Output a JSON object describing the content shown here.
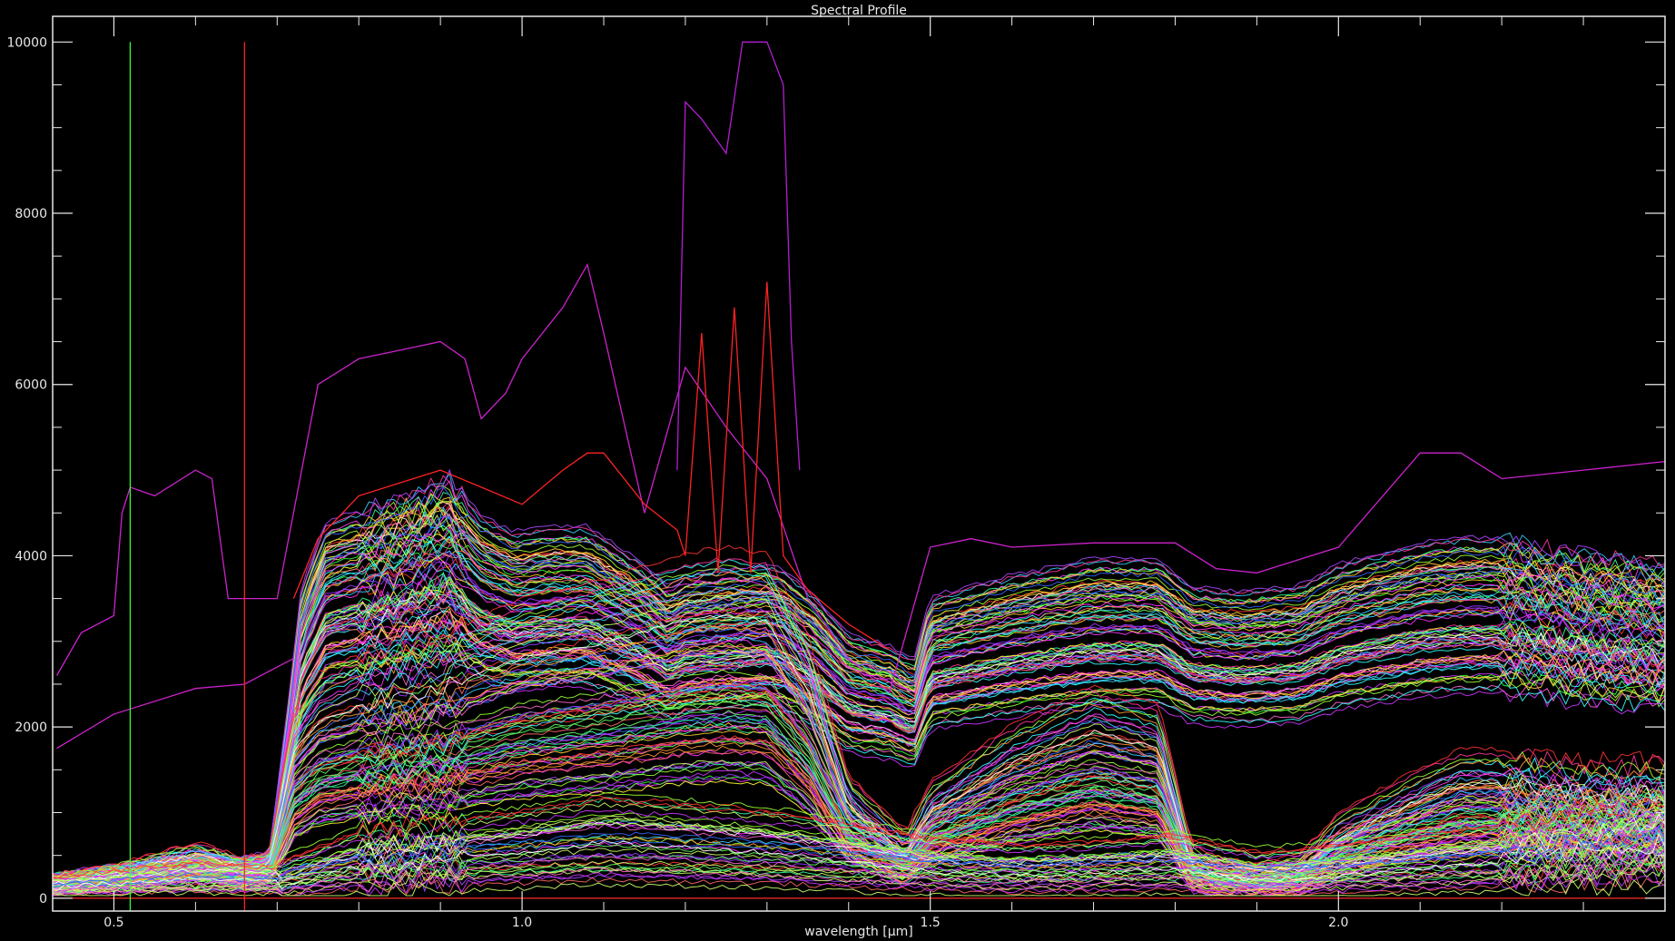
{
  "chart_data": {
    "type": "line",
    "title": "Spectral Profile",
    "xlabel": "wavelength [μm]",
    "ylabel": "",
    "xlim": [
      0.425,
      2.4
    ],
    "ylim": [
      -150,
      10300
    ],
    "x_ticks": [
      0.5,
      1.0,
      1.5,
      2.0
    ],
    "x_tick_labels": [
      "0.5",
      "1.0",
      "1.5",
      "2.0"
    ],
    "y_ticks": [
      0,
      2000,
      4000,
      6000,
      8000,
      10000
    ],
    "y_tick_labels": [
      "0",
      "2000",
      "4000",
      "6000",
      "8000",
      "10000"
    ],
    "y_minor_step": 500,
    "x_minor_step": 0.1,
    "grid": false,
    "background": "#000000",
    "axis_color": "#e8e8e8",
    "markers": [
      {
        "x": 0.52,
        "color": "#33ff33"
      },
      {
        "x": 0.66,
        "color": "#ff2222"
      }
    ],
    "baseline": {
      "y": 0,
      "color": "#ff2a2a"
    },
    "series": [
      {
        "color": "#cc22cc",
        "x": [
          0.43,
          0.46,
          0.5,
          0.51,
          0.52,
          0.55,
          0.6,
          0.62,
          0.64,
          0.7,
          0.75,
          0.8,
          0.85,
          0.9,
          0.93,
          0.95,
          0.98,
          1.0,
          1.05,
          1.08,
          1.1,
          1.15,
          1.2,
          1.25,
          1.3,
          1.35,
          1.4,
          1.45,
          1.5,
          1.55,
          1.6,
          1.7,
          1.8,
          1.85,
          1.9,
          2.0,
          2.1,
          2.15,
          2.2,
          2.3,
          2.4
        ],
        "y": [
          2600,
          3100,
          3300,
          4500,
          4800,
          4700,
          5000,
          4900,
          3500,
          3500,
          6000,
          6300,
          6400,
          6500,
          6300,
          5600,
          5900,
          6300,
          6900,
          7400,
          6600,
          4500,
          6200,
          5500,
          4900,
          3500,
          2800,
          2400,
          4100,
          4200,
          4100,
          4150,
          4150,
          3850,
          3800,
          4100,
          5200,
          5200,
          4900,
          5000,
          5100
        ]
      },
      {
        "color": "#cc22cc",
        "x": [
          0.43,
          0.5,
          0.6,
          0.66,
          0.7,
          0.72
        ],
        "y": [
          1750,
          2150,
          2450,
          2500,
          2700,
          2800
        ]
      },
      {
        "color": "#b21ed2",
        "x": [
          1.19,
          1.2,
          1.22,
          1.25,
          1.27,
          1.3,
          1.32,
          1.33,
          1.34
        ],
        "y": [
          5000,
          9300,
          9100,
          8700,
          10000,
          10000,
          9500,
          6500,
          5000
        ]
      },
      {
        "color": "#ff2222",
        "x": [
          0.72,
          0.75,
          0.8,
          0.9,
          0.95,
          1.0,
          1.05,
          1.08,
          1.1,
          1.15,
          1.19,
          1.2,
          1.22,
          1.24,
          1.26,
          1.28,
          1.3,
          1.32,
          1.35,
          1.4,
          1.45
        ],
        "y": [
          3500,
          4200,
          4700,
          5000,
          4800,
          4600,
          5000,
          5200,
          5200,
          4600,
          4300,
          4000,
          6600,
          3800,
          6900,
          3800,
          7200,
          4000,
          3600,
          3200,
          2900
        ]
      }
    ],
    "bundle_groups": [
      {
        "n": 85,
        "shape": "high",
        "x": [
          0.43,
          0.5,
          0.6,
          0.66,
          0.69,
          0.71,
          0.73,
          0.76,
          0.8,
          0.86,
          0.91,
          0.95,
          0.99,
          1.04,
          1.08,
          1.1,
          1.15,
          1.18,
          1.2,
          1.25,
          1.3,
          1.32,
          1.36,
          1.4,
          1.45,
          1.48,
          1.5,
          1.6,
          1.7,
          1.78,
          1.82,
          1.88,
          1.95,
          2.0,
          2.1,
          2.15,
          2.2,
          2.3,
          2.4
        ],
        "y": [
          200,
          280,
          380,
          350,
          400,
          1500,
          2800,
          3400,
          3500,
          3650,
          3800,
          3450,
          3300,
          3350,
          3350,
          3250,
          3000,
          2800,
          2900,
          2950,
          3000,
          2950,
          2700,
          2350,
          2250,
          2100,
          2700,
          2900,
          3050,
          3050,
          2800,
          2750,
          2800,
          3000,
          3200,
          3250,
          3250,
          3100,
          3000
        ],
        "spread": 0.28
      },
      {
        "n": 75,
        "shape": "mid",
        "x": [
          0.43,
          0.5,
          0.6,
          0.66,
          0.69,
          0.72,
          0.75,
          0.8,
          0.9,
          0.95,
          1.0,
          1.1,
          1.2,
          1.25,
          1.3,
          1.35,
          1.4,
          1.44,
          1.47,
          1.5,
          1.6,
          1.7,
          1.78,
          1.82,
          1.85,
          1.9,
          1.95,
          2.0,
          2.1,
          2.15,
          2.2,
          2.3,
          2.4
        ],
        "y": [
          150,
          250,
          420,
          300,
          330,
          1400,
          1700,
          1850,
          2000,
          2150,
          2300,
          2450,
          2650,
          2700,
          2650,
          2000,
          900,
          650,
          450,
          850,
          1300,
          1600,
          1450,
          350,
          250,
          200,
          250,
          600,
          950,
          1100,
          1100,
          1000,
          1000
        ],
        "spread": 0.5
      },
      {
        "n": 40,
        "shape": "flat",
        "x": [
          0.43,
          0.6,
          0.7,
          0.8,
          1.0,
          1.1,
          1.2,
          1.3,
          1.4,
          1.5,
          1.6,
          1.7,
          1.8,
          1.9,
          2.0,
          2.2,
          2.4
        ],
        "y": [
          150,
          250,
          220,
          450,
          600,
          700,
          650,
          600,
          500,
          400,
          350,
          380,
          420,
          300,
          350,
          500,
          700
        ],
        "spread": 0.7
      }
    ]
  }
}
